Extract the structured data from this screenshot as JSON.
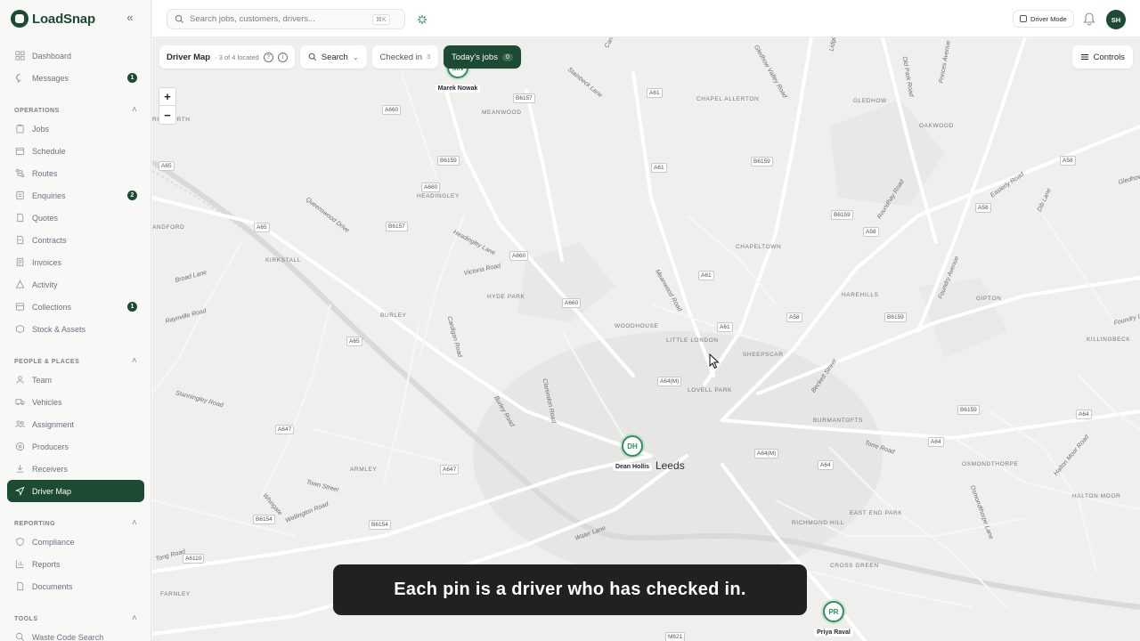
{
  "brand": {
    "name": "LoadSnap",
    "collapse_icon": "«"
  },
  "topbar": {
    "search_placeholder": "Search jobs, customers, drivers...",
    "search_shortcut": "⌘K",
    "driver_mode_label": "Driver Mode",
    "avatar_initials": "SH"
  },
  "sidebar": {
    "top_items": [
      {
        "label": "Dashboard",
        "icon": "dashboard-icon"
      },
      {
        "label": "Messages",
        "icon": "message-icon",
        "badge": "1"
      }
    ],
    "sections": [
      {
        "title": "OPERATIONS",
        "items": [
          {
            "label": "Jobs",
            "icon": "clipboard-icon"
          },
          {
            "label": "Schedule",
            "icon": "calendar-icon"
          },
          {
            "label": "Routes",
            "icon": "route-icon"
          },
          {
            "label": "Enquiries",
            "icon": "enquiry-icon",
            "badge": "2"
          },
          {
            "label": "Quotes",
            "icon": "quote-icon"
          },
          {
            "label": "Contracts",
            "icon": "contract-icon"
          },
          {
            "label": "Invoices",
            "icon": "invoice-icon"
          },
          {
            "label": "Activity",
            "icon": "activity-icon"
          },
          {
            "label": "Collections",
            "icon": "collection-icon",
            "badge": "1"
          },
          {
            "label": "Stock & Assets",
            "icon": "box-icon"
          }
        ]
      },
      {
        "title": "PEOPLE & PLACES",
        "items": [
          {
            "label": "Team",
            "icon": "team-icon"
          },
          {
            "label": "Vehicles",
            "icon": "truck-icon"
          },
          {
            "label": "Assignment",
            "icon": "assignment-icon"
          },
          {
            "label": "Producers",
            "icon": "location-icon"
          },
          {
            "label": "Receivers",
            "icon": "receiver-icon"
          },
          {
            "label": "Driver Map",
            "icon": "navigation-icon",
            "active": true
          }
        ]
      },
      {
        "title": "REPORTING",
        "items": [
          {
            "label": "Compliance",
            "icon": "shield-icon"
          },
          {
            "label": "Reports",
            "icon": "chart-icon"
          },
          {
            "label": "Documents",
            "icon": "document-icon"
          }
        ]
      },
      {
        "title": "TOOLS",
        "items": [
          {
            "label": "Waste Code Search",
            "icon": "search-icon"
          }
        ]
      }
    ]
  },
  "map": {
    "toolbar": {
      "title": "Driver Map",
      "subtitle": "· 3 of 4 located",
      "search_label": "Search",
      "checked_in_label": "Checked in",
      "checked_in_count": "3",
      "todays_jobs_label": "Today's jobs",
      "todays_jobs_count": "0",
      "controls_label": "Controls"
    },
    "zoom": {
      "in": "+",
      "out": "−"
    },
    "city_label": "Leeds",
    "pins": [
      {
        "initials": "MN",
        "name": "Marek Nowak"
      },
      {
        "initials": "DH",
        "name": "Dean Hollis"
      },
      {
        "initials": "PR",
        "name": "Priya Raval"
      }
    ],
    "area_labels": [
      "KIRKSTALL",
      "HEADINGLEY",
      "MEANWOOD",
      "CHAPEL ALLERTON",
      "CHAPELTOWN",
      "HAREHILLS",
      "GIPTON",
      "OAKWOOD",
      "GLEDHOW",
      "HYDE PARK",
      "BURLEY",
      "WOODHOUSE",
      "LITTLE LONDON",
      "SHEEPSCAR",
      "LOVELL PARK",
      "BURMANTOFTS",
      "ARMLEY",
      "OSMONDTHORPE",
      "EAST END PARK",
      "RICHMOND HILL",
      "CROSS GREEN",
      "HALTON MOOR",
      "KILLINGBECK",
      "FARNLEY",
      "RKSWORTH",
      "ANDFORD"
    ],
    "road_labels": [
      "Queenswood Drive",
      "Headingley Lane",
      "Victoria Road",
      "Cardigan Road",
      "Burley Road",
      "Clarendon Road",
      "Meanwood Road",
      "Roundhay Road",
      "Easterly Road",
      "Dib Lane",
      "Foundry Avenue",
      "Beckett Street",
      "Torre Road",
      "Broad Lane",
      "Raynville Road",
      "Stanningley Road",
      "Town Street",
      "Whingate",
      "Tong Road",
      "Wellington Road",
      "Water Lane",
      "Halton Moor Road",
      "Osmondthorpe Lane",
      "Foundry Lane",
      "Gledhow Valley Road",
      "Lidgett Lane",
      "Old Park Road",
      "Princes Avenue",
      "Stainbeck Lane",
      "Carr Manor",
      "Gledhow Lane"
    ],
    "road_shields": [
      "A660",
      "B6157",
      "A61",
      "A65",
      "B6159",
      "A660",
      "A65",
      "B6157",
      "A660",
      "A660",
      "A61",
      "A61",
      "A58",
      "B6159",
      "A64(M)",
      "B6159",
      "A65",
      "A647",
      "A64(M)",
      "A64",
      "A64",
      "A647",
      "B6154",
      "B6154",
      "A6110",
      "A58",
      "B6159",
      "B6159",
      "A58",
      "M621",
      "A58",
      "A61",
      "A64"
    ]
  },
  "caption": "Each pin is a driver who has checked in."
}
